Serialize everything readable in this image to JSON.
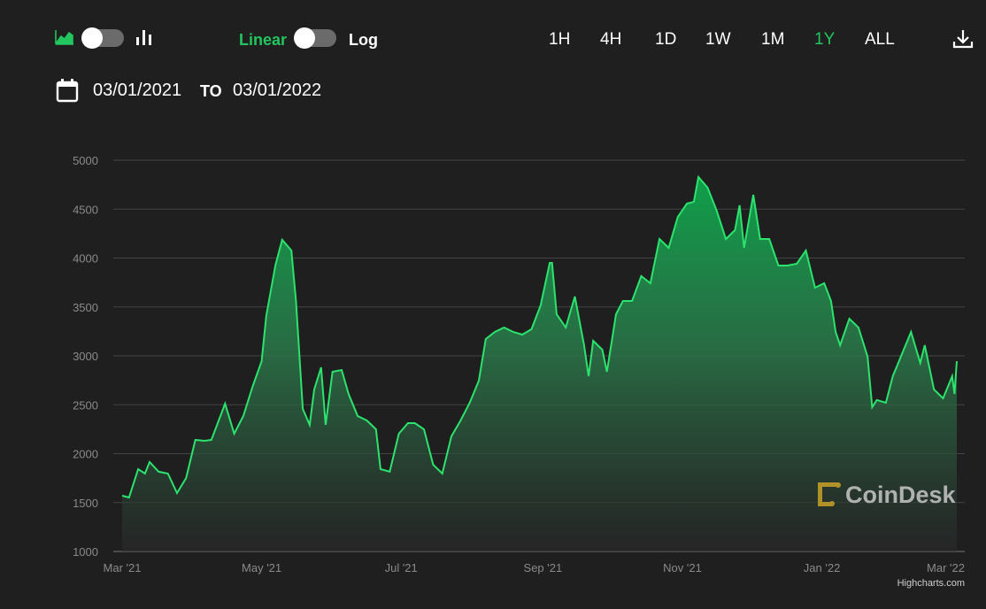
{
  "toolbar": {
    "chart_type_icons": [
      "area-chart-icon",
      "bar-chart-icon"
    ],
    "scale_linear": "Linear",
    "scale_log": "Log",
    "ranges": [
      "1H",
      "4H",
      "1D",
      "1W",
      "1M",
      "1Y",
      "ALL"
    ],
    "active_range": "1Y",
    "download_icon": "download-icon"
  },
  "date_range": {
    "from": "03/01/2021",
    "to_label": "TO",
    "to": "03/01/2022"
  },
  "colors": {
    "accent": "#22c55e",
    "line": "#2be36d",
    "background": "#1f1f1f"
  },
  "watermark": "CoinDesk",
  "credits": "Highcharts.com",
  "chart_data": {
    "type": "area",
    "title": "",
    "xlabel": "",
    "ylabel": "",
    "ylim": [
      1000,
      5000
    ],
    "xlim_days": [
      0,
      365
    ],
    "yticks": [
      1000,
      1500,
      2000,
      2500,
      3000,
      3500,
      4000,
      4500,
      5000
    ],
    "xticks": [
      {
        "day": 0,
        "label": "Mar '21"
      },
      {
        "day": 61,
        "label": "May '21"
      },
      {
        "day": 122,
        "label": "Jul '21"
      },
      {
        "day": 184,
        "label": "Sep '21"
      },
      {
        "day": 245,
        "label": "Nov '21"
      },
      {
        "day": 306,
        "label": "Jan '22"
      },
      {
        "day": 365,
        "label": "Mar '22"
      }
    ],
    "grid": true,
    "days": [
      0,
      3,
      7,
      10,
      12,
      16,
      20,
      24,
      28,
      32,
      36,
      39,
      45,
      49,
      53,
      57,
      61,
      63,
      67,
      70,
      74,
      76,
      79,
      82,
      84,
      87,
      89,
      92,
      96,
      99,
      103,
      107,
      111,
      113,
      117,
      121,
      125,
      128,
      132,
      136,
      140,
      144,
      148,
      152,
      156,
      159,
      163,
      167,
      171,
      175,
      179,
      183,
      187,
      188,
      190,
      194,
      198,
      202,
      204,
      206,
      210,
      212,
      216,
      219,
      223,
      227,
      231,
      235,
      239,
      243,
      247,
      250,
      252,
      256,
      260,
      264,
      268,
      270,
      272,
      276,
      279,
      283,
      287,
      291,
      295,
      299,
      303,
      307,
      310,
      312,
      314,
      318,
      322,
      326,
      328,
      330,
      334,
      337,
      341,
      345,
      349,
      351,
      355,
      359,
      363,
      364,
      365
    ],
    "values": [
      1570,
      1552,
      1842,
      1796,
      1914,
      1815,
      1796,
      1597,
      1751,
      2140,
      2131,
      2140,
      2511,
      2204,
      2385,
      2683,
      2946,
      3407,
      3923,
      4186,
      4077,
      3561,
      2457,
      2294,
      2656,
      2882,
      2294,
      2837,
      2855,
      2611,
      2385,
      2339,
      2249,
      1842,
      1815,
      2204,
      2312,
      2312,
      2249,
      1887,
      1796,
      2177,
      2339,
      2520,
      2747,
      3172,
      3244,
      3290,
      3244,
      3217,
      3272,
      3516,
      3950,
      3950,
      3425,
      3290,
      3606,
      3109,
      2792,
      3154,
      3063,
      2837,
      3425,
      3561,
      3561,
      3815,
      3742,
      4195,
      4104,
      4421,
      4557,
      4575,
      4828,
      4720,
      4484,
      4195,
      4285,
      4539,
      4104,
      4647,
      4195,
      4195,
      3923,
      3923,
      3941,
      4077,
      3697,
      3742,
      3561,
      3244,
      3109,
      3380,
      3290,
      2991,
      2475,
      2548,
      2520,
      2792,
      3018,
      3244,
      2928,
      3109,
      2656,
      2566,
      2792,
      2611,
      2946
    ]
  }
}
